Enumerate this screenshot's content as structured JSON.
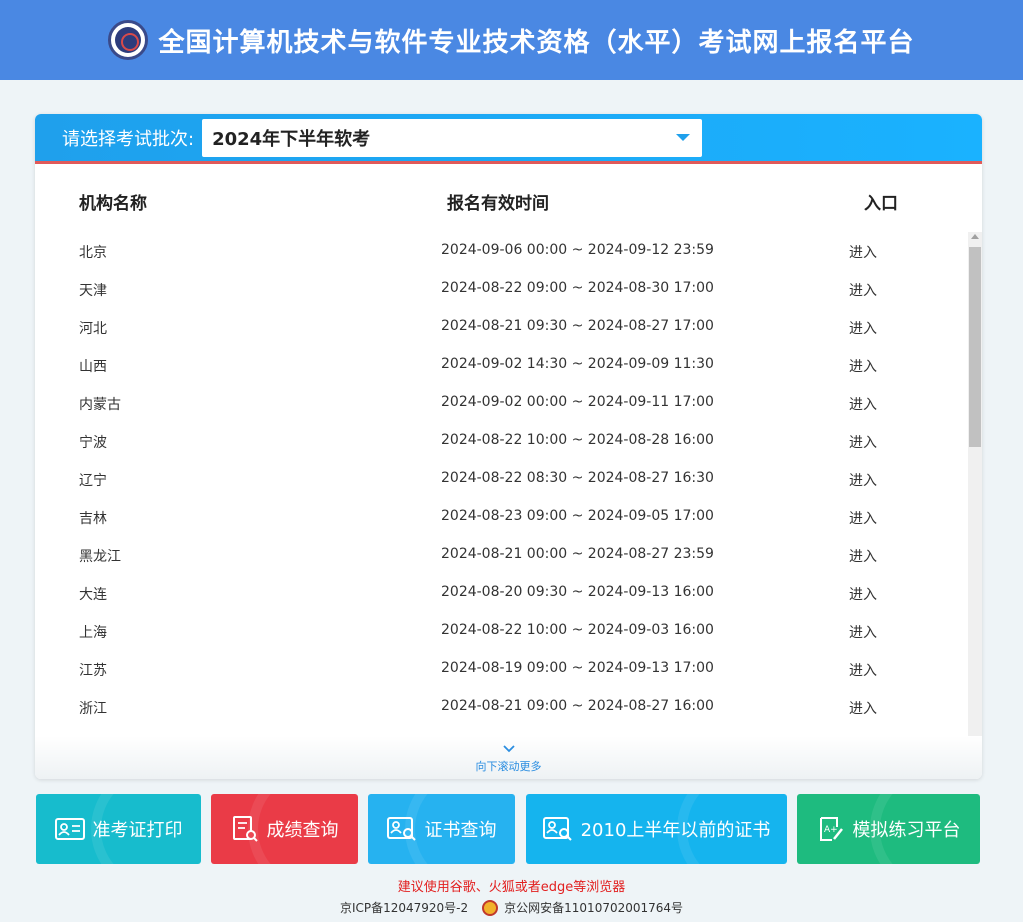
{
  "header": {
    "title": "全国计算机技术与软件专业技术资格（水平）考试网上报名平台"
  },
  "batch": {
    "label": "请选择考试批次:",
    "selected": "2024年下半年软考"
  },
  "table": {
    "col_org": "机构名称",
    "col_time": "报名有效时间",
    "col_entry": "入口",
    "rows": [
      {
        "org": "北京",
        "time": "2024-09-06 00:00 ~ 2024-09-12 23:59",
        "entry": "进入"
      },
      {
        "org": "天津",
        "time": "2024-08-22 09:00 ~ 2024-08-30 17:00",
        "entry": "进入"
      },
      {
        "org": "河北",
        "time": "2024-08-21 09:30 ~ 2024-08-27 17:00",
        "entry": "进入"
      },
      {
        "org": "山西",
        "time": "2024-09-02 14:30 ~ 2024-09-09 11:30",
        "entry": "进入"
      },
      {
        "org": "内蒙古",
        "time": "2024-09-02 00:00 ~ 2024-09-11 17:00",
        "entry": "进入"
      },
      {
        "org": "宁波",
        "time": "2024-08-22 10:00 ~ 2024-08-28 16:00",
        "entry": "进入"
      },
      {
        "org": "辽宁",
        "time": "2024-08-22 08:30 ~ 2024-08-27 16:30",
        "entry": "进入"
      },
      {
        "org": "吉林",
        "time": "2024-08-23 09:00 ~ 2024-09-05 17:00",
        "entry": "进入"
      },
      {
        "org": "黑龙江",
        "time": "2024-08-21 00:00 ~ 2024-08-27 23:59",
        "entry": "进入"
      },
      {
        "org": "大连",
        "time": "2024-08-20 09:30 ~ 2024-09-13 16:00",
        "entry": "进入"
      },
      {
        "org": "上海",
        "time": "2024-08-22 10:00 ~ 2024-09-03 16:00",
        "entry": "进入"
      },
      {
        "org": "江苏",
        "time": "2024-08-19 09:00 ~ 2024-09-13 17:00",
        "entry": "进入"
      },
      {
        "org": "浙江",
        "time": "2024-08-21 09:00 ~ 2024-08-27 16:00",
        "entry": "进入"
      }
    ]
  },
  "scroll_more": "向下滚动更多",
  "buttons": {
    "admit": "准考证打印",
    "score": "成绩查询",
    "cert": "证书查询",
    "old_cert": "2010上半年以前的证书",
    "practice": "模拟练习平台"
  },
  "footer": {
    "browser_tip": "建议使用谷歌、火狐或者edge等浏览器",
    "icp": "京ICP备12047920号-2",
    "police": "京公网安备11010702001764号"
  },
  "colors": {
    "header": "#4a88e3",
    "batch_bar": "#1fa0ec",
    "btn_admit": "#17bccd",
    "btn_score": "#ea3b47",
    "btn_cert": "#26b2f0",
    "btn_old_cert": "#15b4ee",
    "btn_practice": "#1ebb7f"
  }
}
